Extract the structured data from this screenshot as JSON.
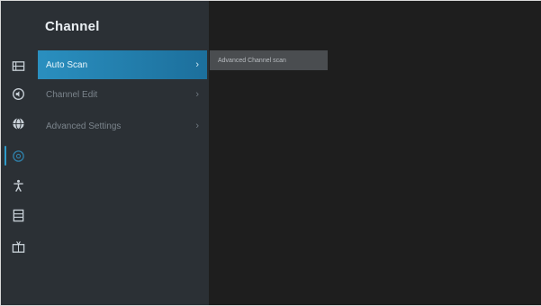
{
  "panel": {
    "title": "Channel"
  },
  "menu": {
    "items": [
      {
        "label": "Auto Scan",
        "selected": true,
        "chevron": "›"
      },
      {
        "label": "Channel Edit",
        "selected": false,
        "chevron": "›"
      },
      {
        "label": "Advanced Settings",
        "selected": false,
        "chevron": "›"
      }
    ]
  },
  "submenu": {
    "items": [
      {
        "label": "Advanced Channel scan"
      }
    ]
  },
  "rail": {
    "icons": [
      "picture-icon",
      "sound-icon",
      "network-icon",
      "channel-icon",
      "accessibility-icon",
      "system-icon",
      "support-icon"
    ],
    "active": "channel-icon",
    "accent": "#2f9bc9"
  }
}
